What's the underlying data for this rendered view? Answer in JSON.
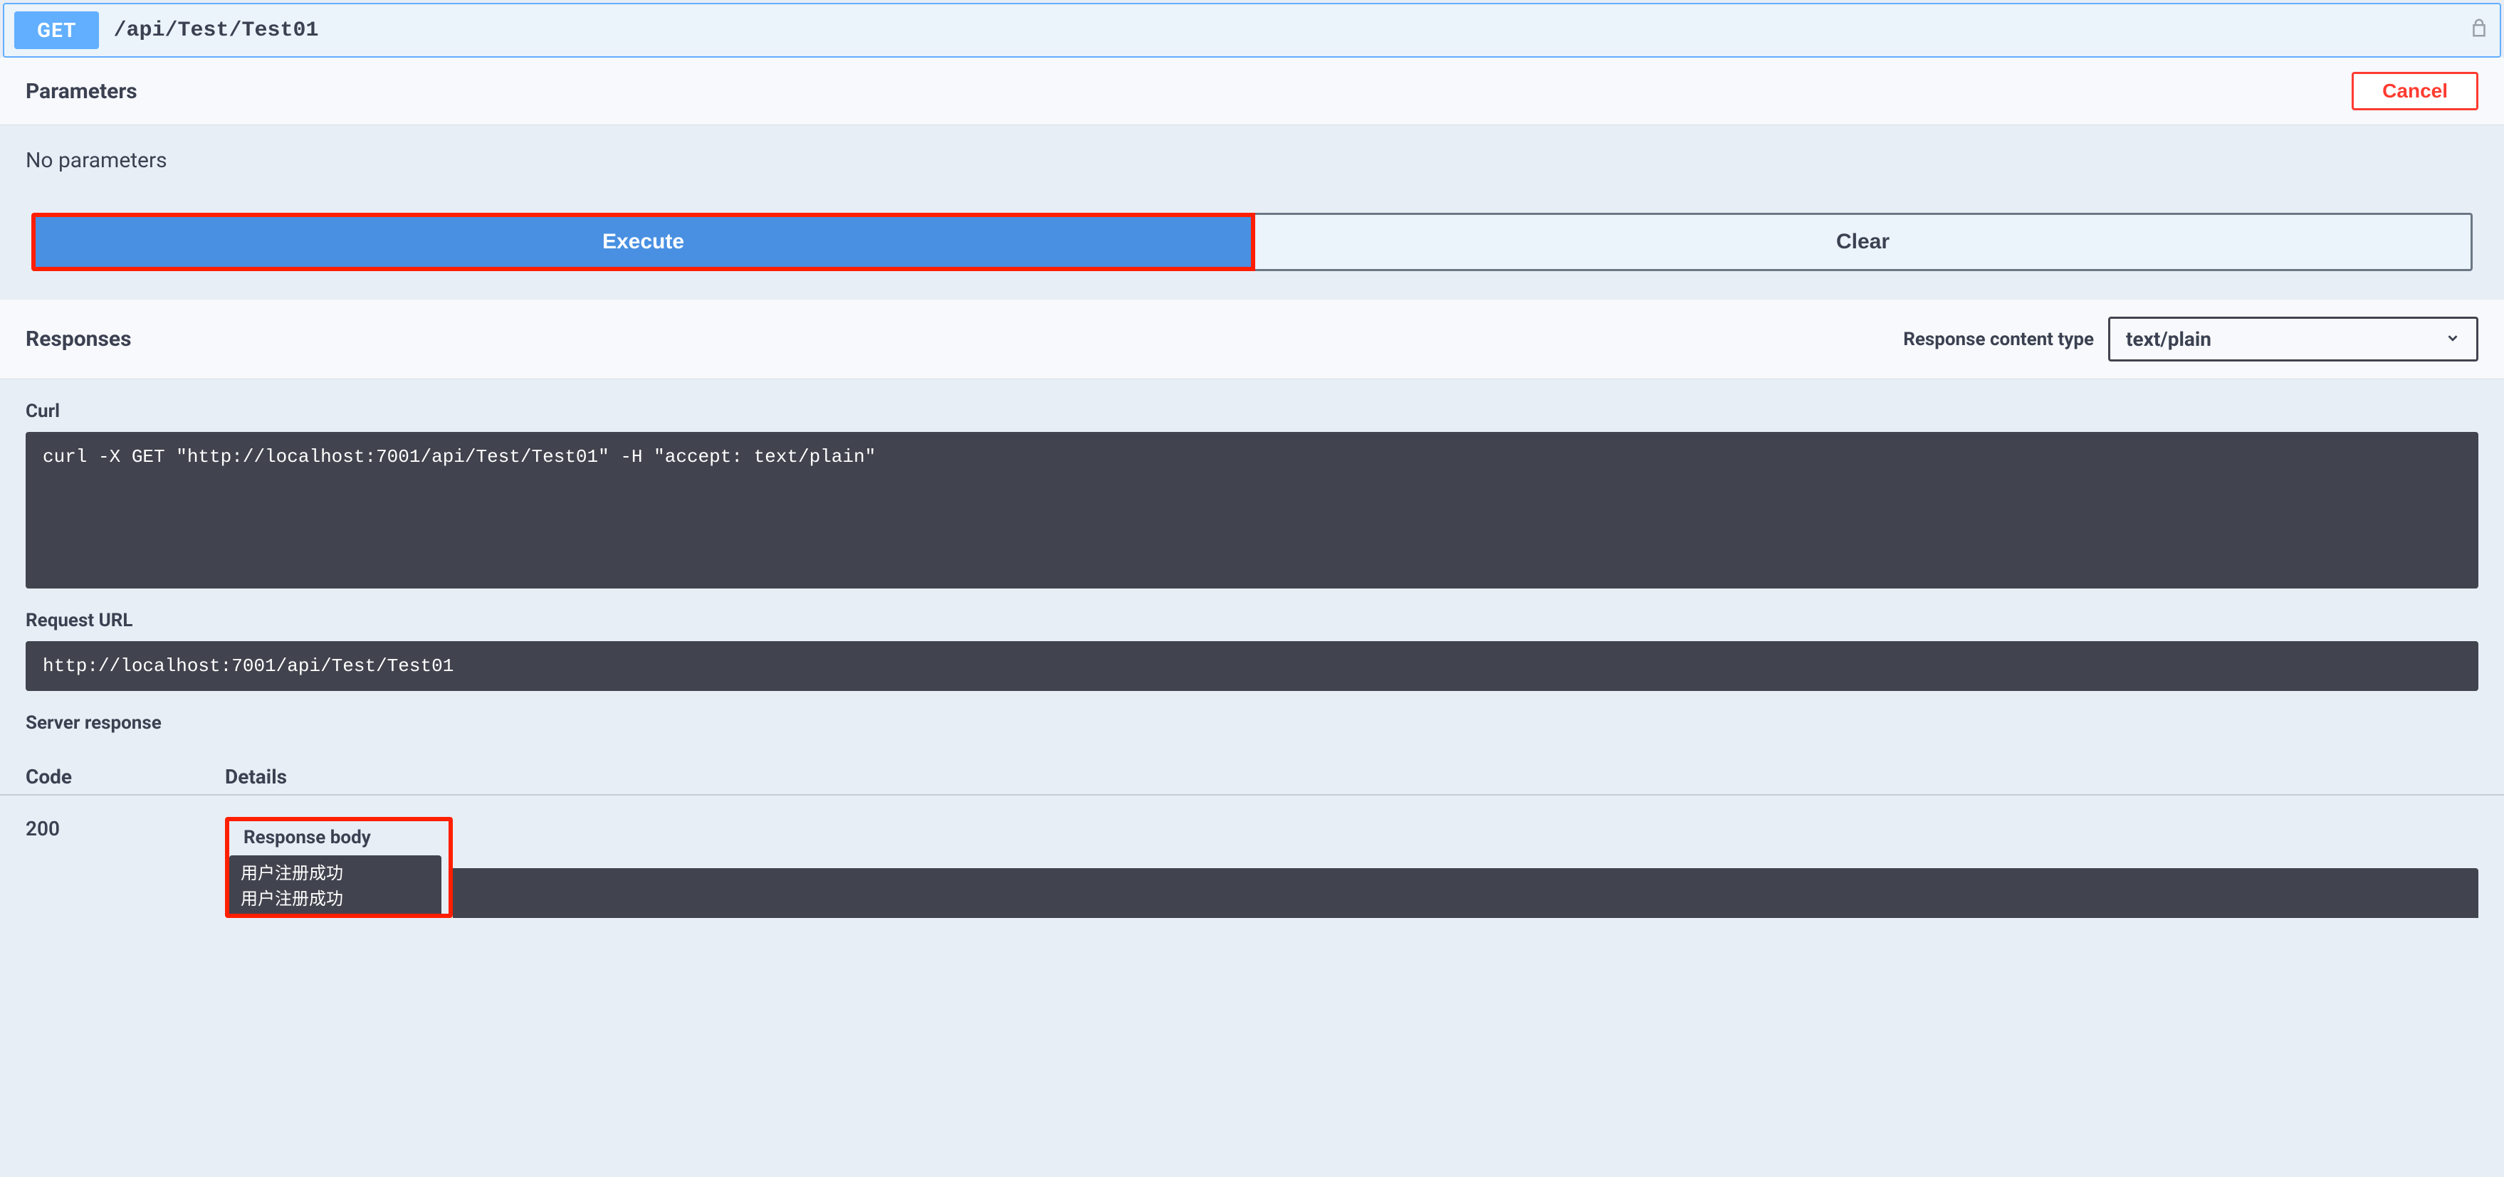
{
  "operation": {
    "method": "GET",
    "path": "/api/Test/Test01"
  },
  "parameters": {
    "title": "Parameters",
    "cancel_label": "Cancel",
    "no_params_text": "No parameters"
  },
  "actions": {
    "execute_label": "Execute",
    "clear_label": "Clear"
  },
  "responses": {
    "title": "Responses",
    "content_type_label": "Response content type",
    "content_type_value": "text/plain"
  },
  "curl": {
    "label": "Curl",
    "command": "curl -X GET \"http://localhost:7001/api/Test/Test01\" -H \"accept: text/plain\""
  },
  "request_url": {
    "label": "Request URL",
    "value": "http://localhost:7001/api/Test/Test01"
  },
  "server_response": {
    "label": "Server response",
    "code_header": "Code",
    "details_header": "Details",
    "status_code": "200",
    "response_body_label": "Response body",
    "response_body_content": "用户注册成功\n用户注册成功"
  }
}
